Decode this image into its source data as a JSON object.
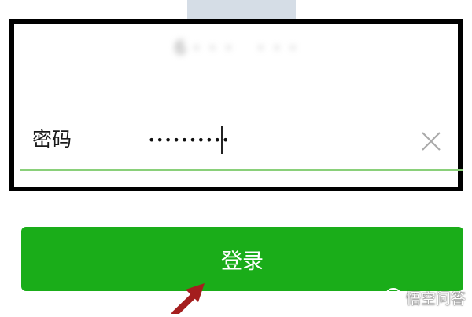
{
  "login_form": {
    "account_value": "6··· ··· 3",
    "password_label": "密码",
    "password_value": "••••••••••",
    "clear_icon": "close-icon"
  },
  "login_button": {
    "label": "登录"
  },
  "annotation": {
    "arrow_icon": "arrow-pointer-icon",
    "arrow_color": "#a41e1e",
    "highlight_color": "#000000"
  },
  "watermark": {
    "text": "悟空问答",
    "icon": "chat-bubble-icon"
  },
  "colors": {
    "primary_button": "#1aad19",
    "field_underline": "#8ad07a"
  }
}
